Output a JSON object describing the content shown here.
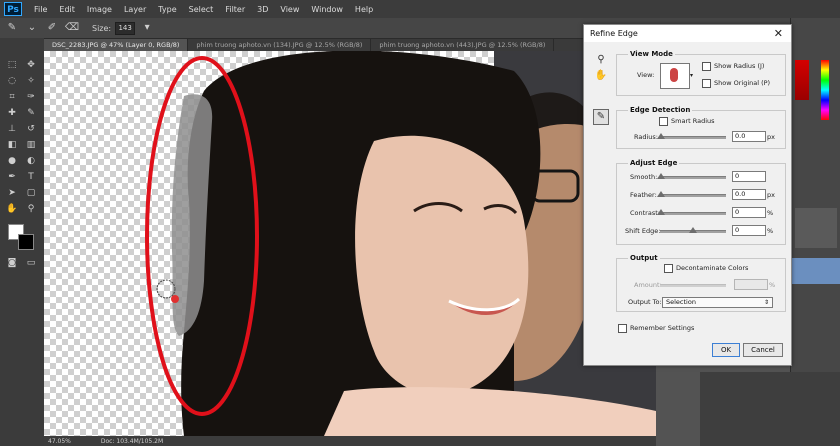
{
  "app": {
    "logo": "Ps"
  },
  "menu": [
    "File",
    "Edit",
    "Image",
    "Layer",
    "Type",
    "Select",
    "Filter",
    "3D",
    "View",
    "Window",
    "Help"
  ],
  "options_bar": {
    "size_label": "Size:",
    "size_value": "143"
  },
  "tabs": [
    {
      "label": "DSC_2283.JPG @ 47% (Layer 0, RGB/8)",
      "active": true
    },
    {
      "label": "phim truong aphoto.vn (134).JPG @ 12.5% (RGB/8)",
      "active": false
    },
    {
      "label": "phim truong aphoto.vn (443).JPG @ 12.5% (RGB/8)",
      "active": false
    }
  ],
  "status": {
    "zoom": "47.05%",
    "doc": "Doc: 103.4M/105.2M"
  },
  "dialog": {
    "title": "Refine Edge",
    "view_mode": {
      "heading": "View Mode",
      "view_label": "View:",
      "show_radius": "Show Radius (J)",
      "show_original": "Show Original (P)"
    },
    "edge_detection": {
      "heading": "Edge Detection",
      "smart_radius": "Smart Radius",
      "radius_label": "Radius:",
      "radius_value": "0.0",
      "radius_unit": "px"
    },
    "adjust_edge": {
      "heading": "Adjust Edge",
      "smooth_label": "Smooth:",
      "smooth_value": "0",
      "feather_label": "Feather:",
      "feather_value": "0.0",
      "feather_unit": "px",
      "contrast_label": "Contrast:",
      "contrast_value": "0",
      "contrast_unit": "%",
      "shift_label": "Shift Edge:",
      "shift_value": "0",
      "shift_unit": "%"
    },
    "output": {
      "heading": "Output",
      "decontaminate": "Decontaminate Colors",
      "amount_label": "Amount:",
      "amount_unit": "%",
      "output_to_label": "Output To:",
      "output_to_value": "Selection"
    },
    "remember": "Remember Settings",
    "ok": "OK",
    "cancel": "Cancel"
  },
  "colors": {
    "annotation_ellipse": "#e0101a",
    "brush_dot": "#e03030"
  }
}
